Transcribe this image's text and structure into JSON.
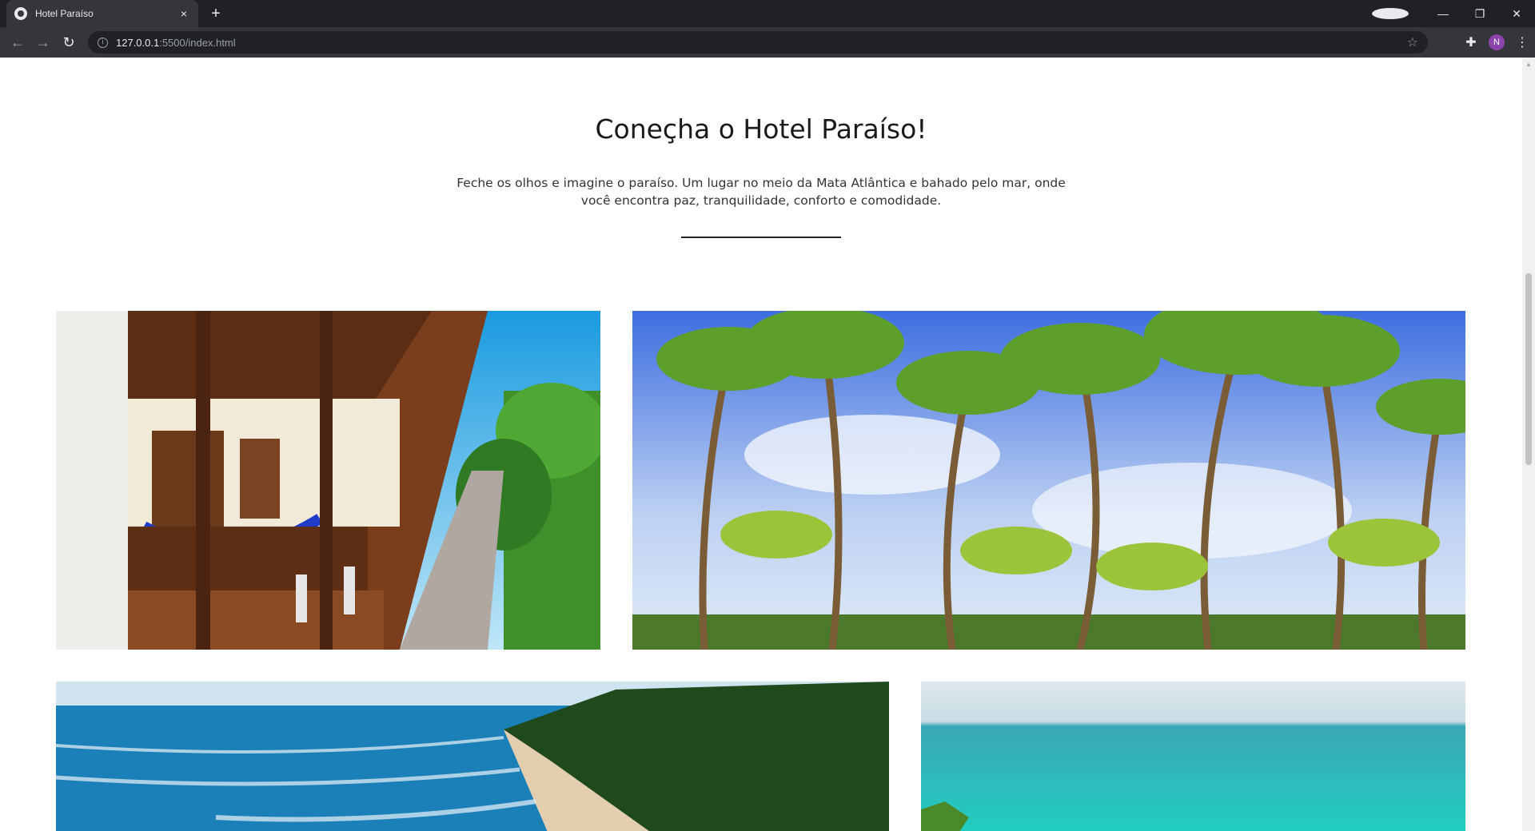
{
  "browser": {
    "tab_title": "Hotel Paraíso",
    "tab_close": "×",
    "new_tab": "+",
    "url_host": "127.0.0.1",
    "url_rest": ":5500/index.html",
    "profile_initial": "N",
    "icons": {
      "back": "arrow-left-icon",
      "forward": "arrow-right-icon",
      "reload": "reload-icon",
      "info": "info-icon",
      "star": "star-icon",
      "extensions": "puzzle-icon",
      "menu": "kebab-menu-icon"
    }
  },
  "page": {
    "heading": "Coneçha o Hotel Paraíso!",
    "intro": "Feche os olhos e imagine o paraíso. Um lugar no meio da Mata Atlântica e bahado pelo mar, onde você encontra paz, tranquilidade, conforto e comodidade.",
    "gallery": [
      {
        "subject": "hotel-balcony-hammocks-photo"
      },
      {
        "subject": "palm-trees-photo"
      },
      {
        "subject": "beach-shore-photo"
      },
      {
        "subject": "turquoise-sea-photo"
      }
    ]
  },
  "colors": {
    "chrome_dark": "#202124",
    "chrome_tab": "#35363a",
    "avatar": "#8e44ad",
    "text_dark": "#1a1a1a"
  }
}
